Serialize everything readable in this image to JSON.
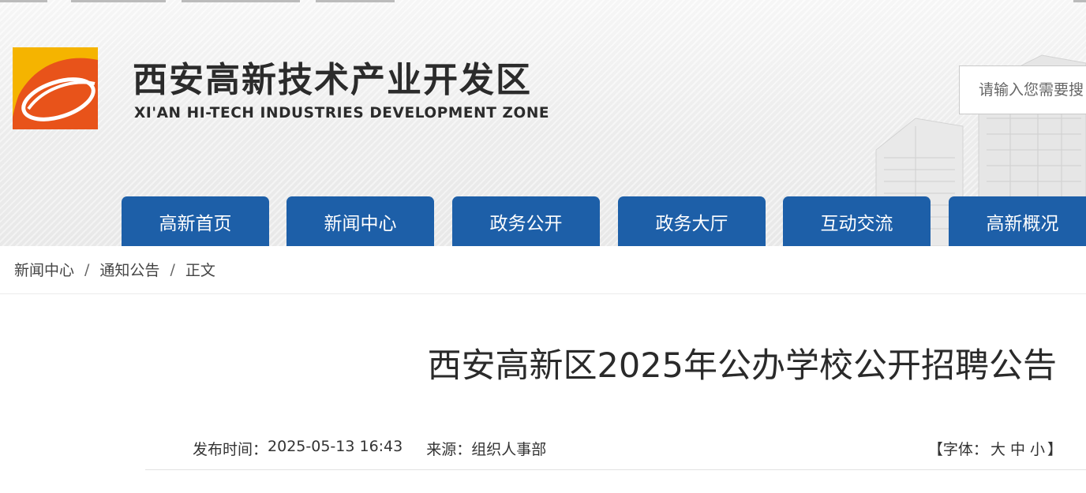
{
  "header": {
    "title_cn": "西安高新技术产业开发区",
    "title_en": "XI'AN HI-TECH INDUSTRIES DEVELOPMENT ZONE",
    "logo_icon": "xian-hitech-logo",
    "search_placeholder": "请输入您需要搜",
    "colors": {
      "nav_blue": "#1d5fa8",
      "logo_orange": "#e8531a",
      "logo_yellow": "#f5b400"
    }
  },
  "nav": {
    "items": [
      {
        "label": "高新首页"
      },
      {
        "label": "新闻中心"
      },
      {
        "label": "政务公开"
      },
      {
        "label": "政务大厅"
      },
      {
        "label": "互动交流"
      },
      {
        "label": "高新概况"
      }
    ]
  },
  "breadcrumb": {
    "items": [
      "新闻中心",
      "通知公告",
      "正文"
    ],
    "separator": "/"
  },
  "article": {
    "title": "西安高新区2025年公办学校公开招聘公告",
    "publish_label": "发布时间：",
    "publish_time": "2025-05-13 16:43",
    "source_label": "来源：",
    "source": "组织人事部",
    "font_open": "【字体：",
    "font_large": "大",
    "font_medium": "中",
    "font_small": "小",
    "font_close": "】"
  }
}
